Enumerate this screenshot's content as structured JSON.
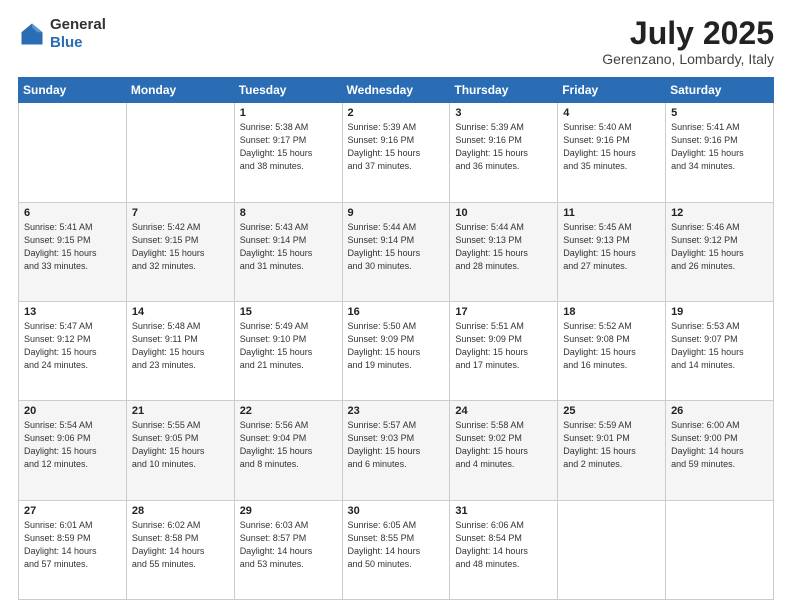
{
  "header": {
    "logo_general": "General",
    "logo_blue": "Blue",
    "month_title": "July 2025",
    "location": "Gerenzano, Lombardy, Italy"
  },
  "days_of_week": [
    "Sunday",
    "Monday",
    "Tuesday",
    "Wednesday",
    "Thursday",
    "Friday",
    "Saturday"
  ],
  "weeks": [
    [
      {
        "num": "",
        "info": ""
      },
      {
        "num": "",
        "info": ""
      },
      {
        "num": "1",
        "info": "Sunrise: 5:38 AM\nSunset: 9:17 PM\nDaylight: 15 hours\nand 38 minutes."
      },
      {
        "num": "2",
        "info": "Sunrise: 5:39 AM\nSunset: 9:16 PM\nDaylight: 15 hours\nand 37 minutes."
      },
      {
        "num": "3",
        "info": "Sunrise: 5:39 AM\nSunset: 9:16 PM\nDaylight: 15 hours\nand 36 minutes."
      },
      {
        "num": "4",
        "info": "Sunrise: 5:40 AM\nSunset: 9:16 PM\nDaylight: 15 hours\nand 35 minutes."
      },
      {
        "num": "5",
        "info": "Sunrise: 5:41 AM\nSunset: 9:16 PM\nDaylight: 15 hours\nand 34 minutes."
      }
    ],
    [
      {
        "num": "6",
        "info": "Sunrise: 5:41 AM\nSunset: 9:15 PM\nDaylight: 15 hours\nand 33 minutes."
      },
      {
        "num": "7",
        "info": "Sunrise: 5:42 AM\nSunset: 9:15 PM\nDaylight: 15 hours\nand 32 minutes."
      },
      {
        "num": "8",
        "info": "Sunrise: 5:43 AM\nSunset: 9:14 PM\nDaylight: 15 hours\nand 31 minutes."
      },
      {
        "num": "9",
        "info": "Sunrise: 5:44 AM\nSunset: 9:14 PM\nDaylight: 15 hours\nand 30 minutes."
      },
      {
        "num": "10",
        "info": "Sunrise: 5:44 AM\nSunset: 9:13 PM\nDaylight: 15 hours\nand 28 minutes."
      },
      {
        "num": "11",
        "info": "Sunrise: 5:45 AM\nSunset: 9:13 PM\nDaylight: 15 hours\nand 27 minutes."
      },
      {
        "num": "12",
        "info": "Sunrise: 5:46 AM\nSunset: 9:12 PM\nDaylight: 15 hours\nand 26 minutes."
      }
    ],
    [
      {
        "num": "13",
        "info": "Sunrise: 5:47 AM\nSunset: 9:12 PM\nDaylight: 15 hours\nand 24 minutes."
      },
      {
        "num": "14",
        "info": "Sunrise: 5:48 AM\nSunset: 9:11 PM\nDaylight: 15 hours\nand 23 minutes."
      },
      {
        "num": "15",
        "info": "Sunrise: 5:49 AM\nSunset: 9:10 PM\nDaylight: 15 hours\nand 21 minutes."
      },
      {
        "num": "16",
        "info": "Sunrise: 5:50 AM\nSunset: 9:09 PM\nDaylight: 15 hours\nand 19 minutes."
      },
      {
        "num": "17",
        "info": "Sunrise: 5:51 AM\nSunset: 9:09 PM\nDaylight: 15 hours\nand 17 minutes."
      },
      {
        "num": "18",
        "info": "Sunrise: 5:52 AM\nSunset: 9:08 PM\nDaylight: 15 hours\nand 16 minutes."
      },
      {
        "num": "19",
        "info": "Sunrise: 5:53 AM\nSunset: 9:07 PM\nDaylight: 15 hours\nand 14 minutes."
      }
    ],
    [
      {
        "num": "20",
        "info": "Sunrise: 5:54 AM\nSunset: 9:06 PM\nDaylight: 15 hours\nand 12 minutes."
      },
      {
        "num": "21",
        "info": "Sunrise: 5:55 AM\nSunset: 9:05 PM\nDaylight: 15 hours\nand 10 minutes."
      },
      {
        "num": "22",
        "info": "Sunrise: 5:56 AM\nSunset: 9:04 PM\nDaylight: 15 hours\nand 8 minutes."
      },
      {
        "num": "23",
        "info": "Sunrise: 5:57 AM\nSunset: 9:03 PM\nDaylight: 15 hours\nand 6 minutes."
      },
      {
        "num": "24",
        "info": "Sunrise: 5:58 AM\nSunset: 9:02 PM\nDaylight: 15 hours\nand 4 minutes."
      },
      {
        "num": "25",
        "info": "Sunrise: 5:59 AM\nSunset: 9:01 PM\nDaylight: 15 hours\nand 2 minutes."
      },
      {
        "num": "26",
        "info": "Sunrise: 6:00 AM\nSunset: 9:00 PM\nDaylight: 14 hours\nand 59 minutes."
      }
    ],
    [
      {
        "num": "27",
        "info": "Sunrise: 6:01 AM\nSunset: 8:59 PM\nDaylight: 14 hours\nand 57 minutes."
      },
      {
        "num": "28",
        "info": "Sunrise: 6:02 AM\nSunset: 8:58 PM\nDaylight: 14 hours\nand 55 minutes."
      },
      {
        "num": "29",
        "info": "Sunrise: 6:03 AM\nSunset: 8:57 PM\nDaylight: 14 hours\nand 53 minutes."
      },
      {
        "num": "30",
        "info": "Sunrise: 6:05 AM\nSunset: 8:55 PM\nDaylight: 14 hours\nand 50 minutes."
      },
      {
        "num": "31",
        "info": "Sunrise: 6:06 AM\nSunset: 8:54 PM\nDaylight: 14 hours\nand 48 minutes."
      },
      {
        "num": "",
        "info": ""
      },
      {
        "num": "",
        "info": ""
      }
    ]
  ]
}
